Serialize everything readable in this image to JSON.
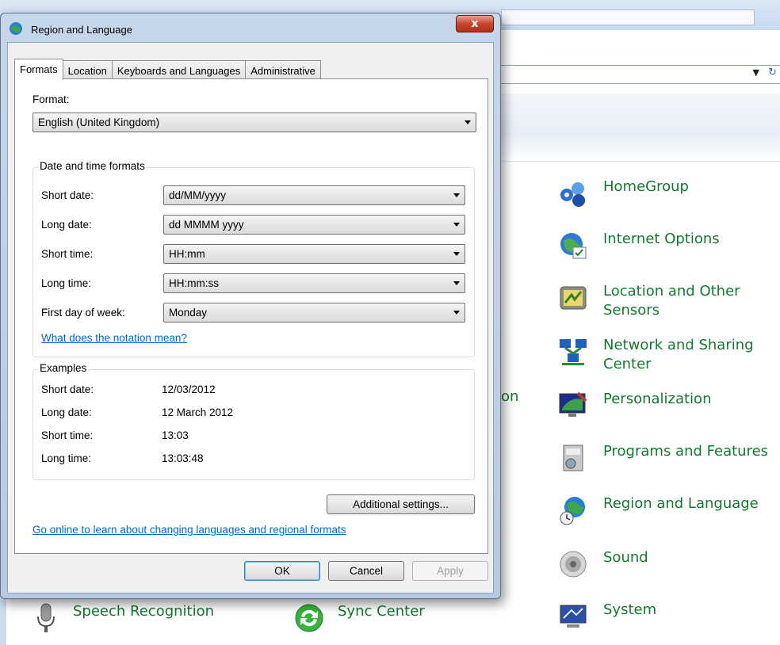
{
  "dialog": {
    "title": "Region and Language",
    "close_label": "x",
    "tabs": [
      {
        "label": "Formats"
      },
      {
        "label": "Location"
      },
      {
        "label": "Keyboards and Languages"
      },
      {
        "label": "Administrative"
      }
    ],
    "format": {
      "label": "Format:",
      "value": "English (United Kingdom)"
    },
    "date_time_group": {
      "title": "Date and time formats",
      "rows": [
        {
          "label": "Short date:",
          "value": "dd/MM/yyyy"
        },
        {
          "label": "Long date:",
          "value": "dd MMMM yyyy"
        },
        {
          "label": "Short time:",
          "value": "HH:mm"
        },
        {
          "label": "Long time:",
          "value": "HH:mm:ss"
        },
        {
          "label": "First day of week:",
          "value": "Monday"
        }
      ],
      "notation_link": "What does the notation mean?"
    },
    "examples_group": {
      "title": "Examples",
      "rows": [
        {
          "label": "Short date:",
          "value": "12/03/2012"
        },
        {
          "label": "Long date:",
          "value": "12 March 2012"
        },
        {
          "label": "Short time:",
          "value": "13:03"
        },
        {
          "label": "Long time:",
          "value": "13:03:48"
        }
      ]
    },
    "additional_settings_label": "Additional settings...",
    "online_link": "Go online to learn about changing languages and regional formats",
    "buttons": {
      "ok": "OK",
      "cancel": "Cancel",
      "apply": "Apply"
    }
  },
  "control_panel": {
    "partial_text": "on",
    "items": [
      {
        "label": "HomeGroup",
        "icon": "homegroup-icon"
      },
      {
        "label": "Internet Options",
        "icon": "internet-options-icon"
      },
      {
        "label": "Location and Other Sensors",
        "icon": "location-sensors-icon"
      },
      {
        "label": "Network and Sharing Center",
        "icon": "network-icon"
      },
      {
        "label": "Personalization",
        "icon": "personalization-icon"
      },
      {
        "label": "Programs and Features",
        "icon": "programs-icon"
      },
      {
        "label": "Region and Language",
        "icon": "region-language-icon"
      },
      {
        "label": "Sound",
        "icon": "sound-icon"
      },
      {
        "label": "System",
        "icon": "system-icon"
      },
      {
        "label": "Speech Recognition",
        "icon": "microphone-icon"
      },
      {
        "label": "Sync Center",
        "icon": "sync-icon"
      }
    ]
  },
  "colors": {
    "link_green": "#127a2e",
    "link_blue": "#0066cc",
    "close_red": "#c9442d"
  }
}
